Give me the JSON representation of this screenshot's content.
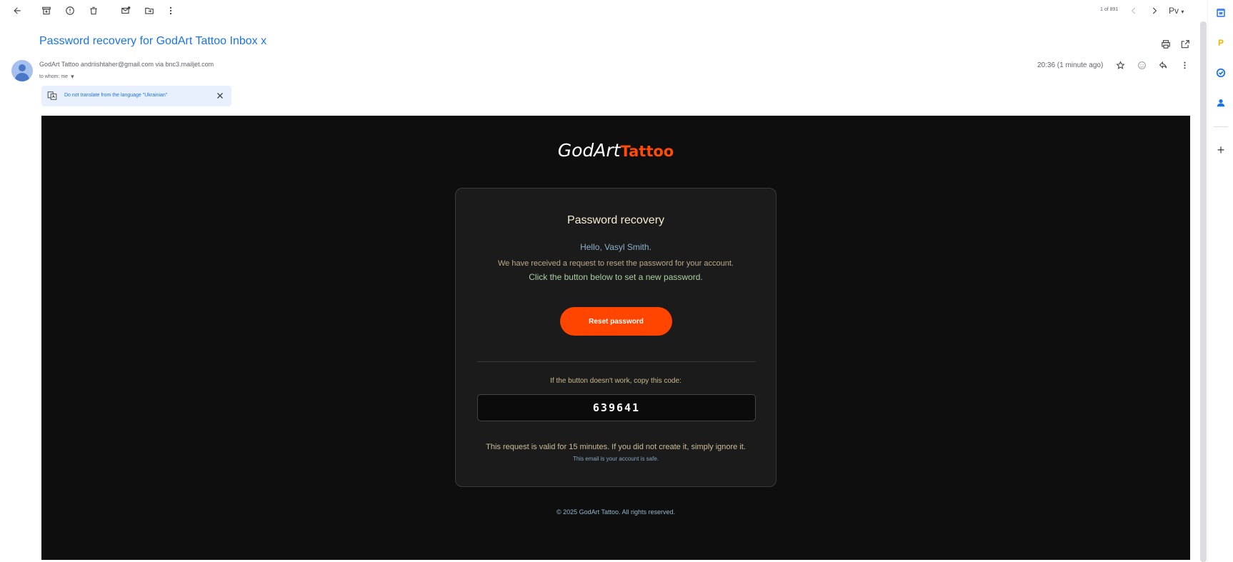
{
  "toolbar": {
    "pager_text": "1 of 891",
    "lang_label": "Рv"
  },
  "message": {
    "subject": "Password recovery for GodArt Tattoo",
    "label": "Inbox x",
    "sender": "GodArt Tattoo andriishtaher@gmail.com via bnc3.mailjet.com",
    "to_whom": "to whom: me",
    "timestamp": "20:36 (1 minute ago)"
  },
  "translate_bar": {
    "text": "Do not translate from the language \"Ukrainian\""
  },
  "email": {
    "logo_main": "GodArt",
    "logo_accent": "Tattoo",
    "title": "Password recovery",
    "greeting": "Hello, Vasyl Smith.",
    "line1": "We have received a request to reset the password for your account.",
    "line2": "Click the button below to set a new password.",
    "button_label": "Reset password",
    "copy_hint": "If the button doesn't work, copy this code:",
    "code": "639641",
    "valid_note": "This request is valid for 15 minutes. If you did not create it, simply ignore it.",
    "safe_note": "This email is your account is safe.",
    "footer": "© 2025 GodArt Tattoo. All rights reserved."
  },
  "colors": {
    "accent": "#ff4500",
    "link_blue": "#1a73e8",
    "email_bg": "#0e0e0e"
  },
  "icons": [
    "back-arrow-icon",
    "archive-icon",
    "report-spam-icon",
    "delete-icon",
    "mark-unread-icon",
    "move-to-icon",
    "more-vert-icon",
    "prev-icon",
    "next-icon",
    "print-icon",
    "open-new-window-icon",
    "star-icon",
    "emoji-icon",
    "reply-icon",
    "translate-icon",
    "close-icon"
  ]
}
